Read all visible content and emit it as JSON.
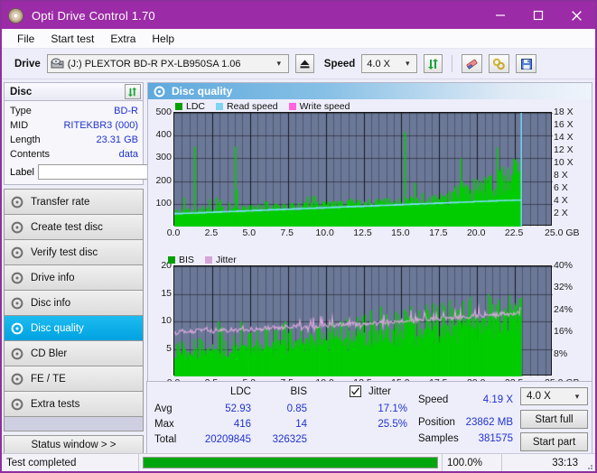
{
  "window": {
    "title": "Opti Drive Control 1.70",
    "app_icon": "disc-icon",
    "minimize": "minimize-icon",
    "maximize": "maximize-icon",
    "close": "close-icon"
  },
  "menu": {
    "items": [
      "File",
      "Start test",
      "Extra",
      "Help"
    ]
  },
  "toolbar": {
    "drive_label": "Drive",
    "drive_value": "(J:)   PLEXTOR BD-R  PX-LB950SA 1.06",
    "eject_icon": "eject-icon",
    "speed_label": "Speed",
    "speed_value": "4.0 X",
    "refresh_icon": "refresh-icon",
    "erase_icon": "eraser-icon",
    "tools_icon": "tools-icon",
    "save_icon": "save-icon"
  },
  "disc_panel": {
    "title": "Disc",
    "refresh_icon": "refresh-icon",
    "rows": [
      {
        "key": "Type",
        "value": "BD-R"
      },
      {
        "key": "MID",
        "value": "RITEKBR3 (000)"
      },
      {
        "key": "Length",
        "value": "23.31 GB"
      },
      {
        "key": "Contents",
        "value": "data"
      }
    ],
    "label_key": "Label",
    "label_value": "",
    "label_placeholder": "",
    "label_button_icon": "disc-icon"
  },
  "nav": {
    "items": [
      {
        "label": "Transfer rate",
        "icon": "disc-transfer-icon",
        "active": false
      },
      {
        "label": "Create test disc",
        "icon": "disc-create-icon",
        "active": false
      },
      {
        "label": "Verify test disc",
        "icon": "disc-verify-icon",
        "active": false
      },
      {
        "label": "Drive info",
        "icon": "disc-drive-icon",
        "active": false
      },
      {
        "label": "Disc info",
        "icon": "disc-info-icon",
        "active": false
      },
      {
        "label": "Disc quality",
        "icon": "disc-quality-icon",
        "active": true
      },
      {
        "label": "CD Bler",
        "icon": "disc-bler-icon",
        "active": false
      },
      {
        "label": "FE / TE",
        "icon": "disc-fete-icon",
        "active": false
      },
      {
        "label": "Extra tests",
        "icon": "disc-extra-icon",
        "active": false
      }
    ],
    "status_window": "Status window > >"
  },
  "content": {
    "header_title": "Disc quality",
    "header_icon": "disc-quality-icon"
  },
  "stats": {
    "col_headers": [
      "LDC",
      "BIS"
    ],
    "rows": [
      {
        "label": "Avg",
        "ldc": "52.93",
        "bis": "0.85",
        "jitter": "17.1%"
      },
      {
        "label": "Max",
        "ldc": "416",
        "bis": "14",
        "jitter": "25.5%"
      },
      {
        "label": "Total",
        "ldc": "20209845",
        "bis": "326325",
        "jitter": ""
      }
    ],
    "jitter_label": "Jitter",
    "jitter_checked": true,
    "speed_label": "Speed",
    "speed_value": "4.19 X",
    "position_label": "Position",
    "position_value": "23862 MB",
    "samples_label": "Samples",
    "samples_value": "381575",
    "speed_select": "4.0 X",
    "start_full": "Start full",
    "start_part": "Start part"
  },
  "statusbar": {
    "message": "Test completed",
    "percent_text": "100.0%",
    "percent_value": 100,
    "elapsed": "33:13"
  },
  "colors": {
    "title_bar": "#9b2ba6",
    "accent_selected": "#00a2e0",
    "ldc_green": "#00cc00",
    "read_speed": "#7fdfff",
    "write_speed": "#ff66dd",
    "bis_green": "#00cc00",
    "jitter_pink": "#dba8dd",
    "plot_background": "#6b7898",
    "value_blue": "#2033cc",
    "progress_green": "#00a60e"
  },
  "chart_data": [
    {
      "type": "area",
      "name": "quality-top-chart",
      "title": "",
      "xlabel": "GB",
      "ylabel": "",
      "xlim": [
        0,
        25
      ],
      "ylim": [
        0,
        500
      ],
      "y2lim": [
        0,
        18
      ],
      "y2label": "X",
      "grid": true,
      "legend": [
        "LDC",
        "Read speed",
        "Write speed"
      ],
      "legend_position": "top-left",
      "xticks": [
        "0.0",
        "2.5",
        "5.0",
        "7.5",
        "10.0",
        "12.5",
        "15.0",
        "17.5",
        "20.0",
        "22.5",
        "25.0 GB"
      ],
      "yticks": [
        "100",
        "200",
        "300",
        "400",
        "500"
      ],
      "y2ticks": [
        "2 X",
        "4 X",
        "6 X",
        "8 X",
        "10 X",
        "12 X",
        "14 X",
        "16 X",
        "18 X"
      ],
      "data_end_x": 22.9,
      "series": [
        {
          "name": "LDC",
          "color": "#00cc00",
          "kind": "bars",
          "baseline": [
            40,
            42,
            41,
            43,
            44,
            42,
            45,
            44,
            46,
            45,
            47,
            46,
            48,
            47,
            49,
            48,
            50,
            49,
            51,
            50,
            52,
            51,
            53,
            52,
            54,
            53,
            55,
            54,
            56,
            55,
            57,
            56,
            58,
            57,
            59,
            58,
            60,
            59,
            61,
            60,
            62,
            61,
            63,
            62,
            64,
            63,
            65,
            64,
            66,
            65,
            67,
            66,
            68,
            67,
            69,
            68,
            70,
            69,
            71,
            70,
            72,
            71,
            73,
            72,
            74,
            73,
            75,
            74,
            76,
            75,
            77,
            78,
            79,
            80,
            82,
            84,
            86,
            88,
            90,
            92,
            94,
            96,
            98,
            100,
            104,
            108,
            112,
            116,
            120,
            126,
            132,
            140
          ],
          "spikes": [
            {
              "x": 0.6,
              "y": 128
            },
            {
              "x": 1.3,
              "y": 352
            },
            {
              "x": 2.3,
              "y": 120
            },
            {
              "x": 3.0,
              "y": 118
            },
            {
              "x": 3.6,
              "y": 105
            },
            {
              "x": 4.0,
              "y": 352
            },
            {
              "x": 4.1,
              "y": 160
            },
            {
              "x": 6.1,
              "y": 110
            },
            {
              "x": 9.0,
              "y": 104
            },
            {
              "x": 11.6,
              "y": 124
            },
            {
              "x": 12.1,
              "y": 118
            },
            {
              "x": 13.6,
              "y": 116
            },
            {
              "x": 14.2,
              "y": 122
            },
            {
              "x": 15.2,
              "y": 416
            },
            {
              "x": 17.2,
              "y": 140
            },
            {
              "x": 18.9,
              "y": 300
            },
            {
              "x": 20.2,
              "y": 160
            },
            {
              "x": 21.5,
              "y": 240
            },
            {
              "x": 22.0,
              "y": 260
            },
            {
              "x": 22.4,
              "y": 300
            },
            {
              "x": 22.6,
              "y": 280
            }
          ]
        },
        {
          "name": "Read speed",
          "color": "#7fdfff",
          "kind": "step-line",
          "axis": "y2",
          "values": [
            2.05,
            2.1,
            2.15,
            2.2,
            2.26,
            2.3,
            2.35,
            2.4,
            2.45,
            2.5,
            2.55,
            2.6,
            2.66,
            2.7,
            2.75,
            2.8,
            2.86,
            2.9,
            2.95,
            3.0,
            3.05,
            3.1,
            3.16,
            3.2,
            3.25,
            3.3,
            3.36,
            3.4,
            3.45,
            3.5,
            3.56,
            3.6,
            3.65,
            3.7,
            3.76,
            3.8,
            3.86,
            3.9,
            3.96,
            4.0,
            4.05,
            4.1,
            4.14,
            4.17,
            4.19
          ]
        },
        {
          "name": "Write speed",
          "color": "#ff66dd",
          "kind": "none",
          "values": []
        }
      ]
    },
    {
      "type": "area",
      "name": "quality-bottom-chart",
      "title": "",
      "xlabel": "GB",
      "ylabel": "",
      "xlim": [
        0,
        25
      ],
      "ylim": [
        0,
        20
      ],
      "y2lim": [
        0,
        40
      ],
      "y2label": "%",
      "grid": true,
      "legend": [
        "BIS",
        "Jitter"
      ],
      "legend_position": "top-left",
      "xticks": [
        "0.0",
        "2.5",
        "5.0",
        "7.5",
        "10.0",
        "12.5",
        "15.0",
        "17.5",
        "20.0",
        "22.5",
        "25.0 GB"
      ],
      "yticks": [
        "5",
        "10",
        "15",
        "20"
      ],
      "y2ticks": [
        "8%",
        "16%",
        "24%",
        "32%",
        "40%"
      ],
      "data_end_x": 22.9,
      "series": [
        {
          "name": "BIS",
          "color": "#00cc00",
          "kind": "bars",
          "baseline": [
            2.4,
            2.5,
            2.4,
            2.6,
            2.5,
            2.6,
            2.5,
            2.7,
            2.6,
            2.7,
            2.6,
            2.8,
            2.7,
            2.8,
            2.9,
            2.8,
            3.0,
            2.9,
            3.0,
            3.1,
            3.0,
            3.2,
            3.1,
            3.2,
            3.3,
            3.2,
            3.4,
            3.3,
            3.4,
            3.5,
            3.4,
            3.6,
            3.5,
            3.6,
            3.7,
            3.6,
            3.8,
            3.7,
            3.8,
            3.9,
            3.8,
            4.0,
            3.9,
            4.0,
            4.1,
            4.0,
            4.2,
            4.1,
            4.2,
            4.3,
            4.2,
            4.4,
            4.3,
            4.4,
            4.5,
            4.4,
            4.6,
            4.5,
            4.6,
            4.7,
            4.6,
            4.8,
            4.7,
            4.8,
            4.9,
            4.8,
            5.0,
            4.9,
            5.0,
            5.1,
            5.0,
            5.2,
            5.1,
            5.3,
            5.2,
            5.4,
            5.3,
            5.5,
            5.4,
            5.6,
            5.5,
            5.7,
            5.6,
            5.8,
            5.9,
            6.0,
            6.1,
            6.2,
            6.4,
            6.6,
            6.8,
            7.0
          ],
          "peaks": [
            {
              "x": 2.9,
              "y": 10
            },
            {
              "x": 3.1,
              "y": 9
            },
            {
              "x": 4.4,
              "y": 10
            },
            {
              "x": 6.0,
              "y": 9
            },
            {
              "x": 7.3,
              "y": 10
            },
            {
              "x": 9.5,
              "y": 9
            },
            {
              "x": 11.0,
              "y": 10
            },
            {
              "x": 12.4,
              "y": 11
            },
            {
              "x": 14.0,
              "y": 10
            },
            {
              "x": 15.5,
              "y": 11
            },
            {
              "x": 17.1,
              "y": 10
            },
            {
              "x": 18.8,
              "y": 12
            },
            {
              "x": 20.0,
              "y": 11
            },
            {
              "x": 21.4,
              "y": 14
            },
            {
              "x": 22.3,
              "y": 12
            }
          ]
        },
        {
          "name": "Jitter",
          "color": "#dba8dd",
          "kind": "noisy-line",
          "axis": "y2",
          "values": [
            15.0,
            15.8,
            16.4,
            16.0,
            16.6,
            16.2,
            16.8,
            16.4,
            17.0,
            16.6,
            16.2,
            16.8,
            16.4,
            17.0,
            16.6,
            17.2,
            16.8,
            16.4,
            17.0,
            16.6,
            17.2,
            16.8,
            17.4,
            17.0,
            17.6,
            17.2,
            17.8,
            17.4,
            18.0,
            17.6,
            18.2,
            17.8,
            18.4,
            18.0,
            17.6,
            18.2,
            17.8,
            18.4,
            18.0,
            18.6,
            18.2,
            18.8,
            18.4,
            19.0,
            18.6,
            19.2,
            18.8,
            19.4,
            19.0,
            18.6,
            19.2,
            18.8,
            19.4,
            19.0,
            19.6,
            19.2,
            19.8,
            19.4,
            20.0,
            19.6,
            20.2,
            19.8,
            20.4,
            20.0,
            20.6,
            20.2,
            20.8,
            20.4,
            21.0,
            20.6,
            21.2,
            20.8,
            21.4,
            21.0,
            21.6,
            21.2,
            21.8,
            21.4,
            22.0,
            21.6,
            22.2,
            21.8,
            22.4,
            22.0,
            22.6,
            22.2,
            22.8,
            22.4,
            23.0,
            22.6,
            23.2,
            22.8
          ],
          "spike_amplitude": 4.0
        }
      ]
    }
  ]
}
